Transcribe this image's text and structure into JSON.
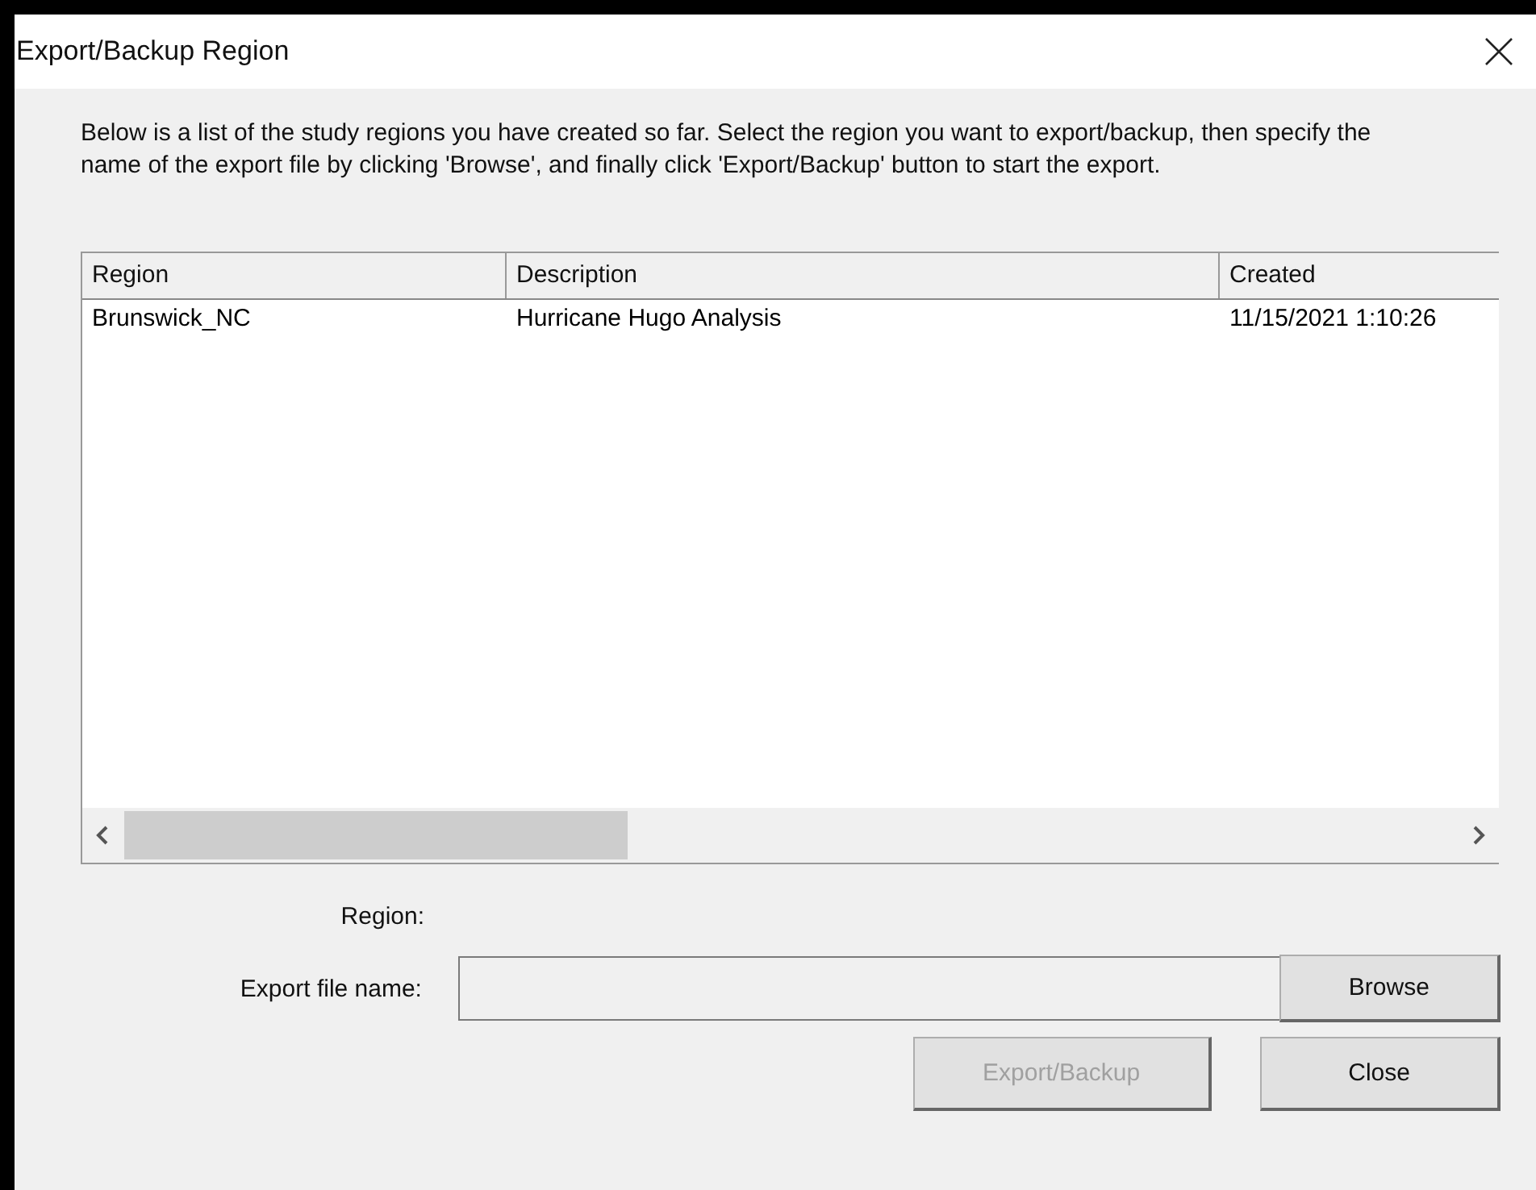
{
  "window": {
    "title": "Export/Backup Region"
  },
  "instructions": "Below is a list of the study regions you have created so far.  Select the region you want to export/backup, then specify the name of the export file by clicking 'Browse', and finally click 'Export/Backup' button to start the export.",
  "table": {
    "columns": [
      "Region",
      "Description",
      "Created"
    ],
    "rows": [
      {
        "cells": [
          "Brunswick_NC",
          "Hurricane Hugo Analysis",
          "11/15/2021 1:10:26"
        ],
        "selected": false
      }
    ]
  },
  "region_label": "Region:",
  "export_file": {
    "label": "Export file name:",
    "browse": "Browse"
  },
  "buttons": [
    {
      "label": "Export/Backup",
      "disabled": true
    },
    {
      "label": "Close",
      "disabled": false
    }
  ]
}
